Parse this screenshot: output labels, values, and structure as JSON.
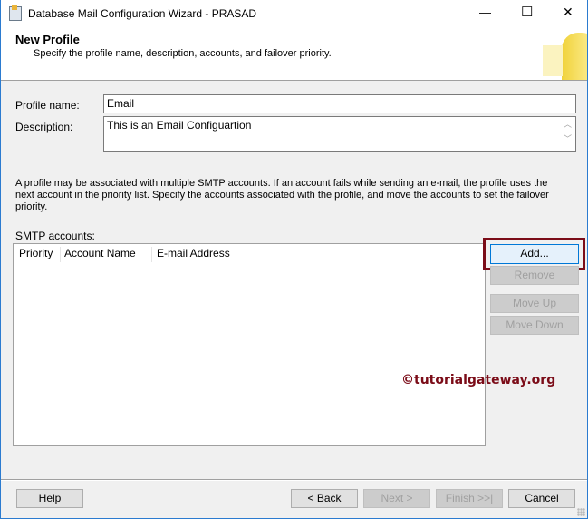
{
  "window": {
    "title": "Database Mail Configuration Wizard - PRASAD",
    "minimize": "—",
    "maximize": "☐",
    "close": "✕"
  },
  "header": {
    "title": "New Profile",
    "subtitle": "Specify the profile name, description, accounts, and failover priority."
  },
  "form": {
    "profile_name_label": "Profile name:",
    "profile_name_value": "Email",
    "description_label": "Description:",
    "description_value": "This is an Email Configuartion"
  },
  "info_text": "A profile may be associated with multiple SMTP accounts. If an account fails while sending an e-mail, the profile uses the next account in the priority list. Specify the accounts associated with the profile, and move the accounts to set the failover priority.",
  "smtp": {
    "label": "SMTP accounts:",
    "columns": [
      "Priority",
      "Account Name",
      "E-mail Address"
    ],
    "rows": []
  },
  "buttons": {
    "add": "Add...",
    "remove": "Remove",
    "move_up": "Move Up",
    "move_down": "Move Down"
  },
  "watermark": "©tutorialgateway.org",
  "footer": {
    "help": "Help",
    "back": "< Back",
    "next": "Next >",
    "finish": "Finish >>|",
    "cancel": "Cancel"
  },
  "colors": {
    "highlight": "#7b0c18",
    "accent": "#0078d7"
  }
}
